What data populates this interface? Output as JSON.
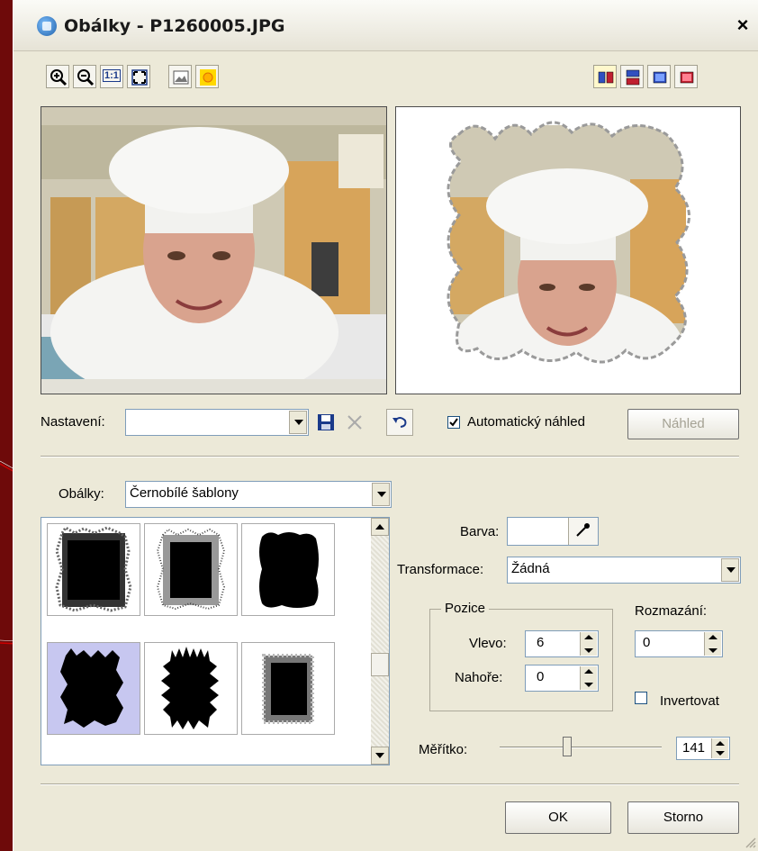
{
  "window": {
    "title": "Obálky - P1260005.JPG",
    "close": "×"
  },
  "toolbar": {
    "left_icons": [
      "zoom-in-icon",
      "zoom-out-icon",
      "actual-size-icon",
      "fit-to-window-icon",
      "image-icon",
      "sun-icon"
    ],
    "actual_size_label": "1:1",
    "right_icons": [
      "split-vertical-icon",
      "split-horizontal-icon",
      "single-original-icon",
      "single-preview-icon"
    ]
  },
  "settings": {
    "label": "Nastavení:",
    "value": "",
    "auto_preview_label": "Automatický náhled",
    "auto_preview_checked": true,
    "preview_button": "Náhled"
  },
  "envelopes": {
    "label": "Obálky:",
    "category": "Černobílé šablony"
  },
  "color": {
    "label": "Barva:",
    "swatch": "#ffffff"
  },
  "transform": {
    "label": "Transformace:",
    "value": "Žádná"
  },
  "position": {
    "legend": "Pozice",
    "left_label": "Vlevo:",
    "left_value": "6",
    "top_label": "Nahoře:",
    "top_value": "0"
  },
  "blur": {
    "label": "Rozmazání:",
    "value": "0"
  },
  "invert": {
    "label": "Invertovat",
    "checked": false
  },
  "scale": {
    "label": "Měřítko:",
    "value": "141"
  },
  "buttons": {
    "ok": "OK",
    "cancel": "Storno"
  },
  "colors": {
    "background": "#6e0a0a",
    "dialog": "#ece9d8",
    "annotation_line": "#cc0000",
    "selection": "#c7c7f0"
  }
}
